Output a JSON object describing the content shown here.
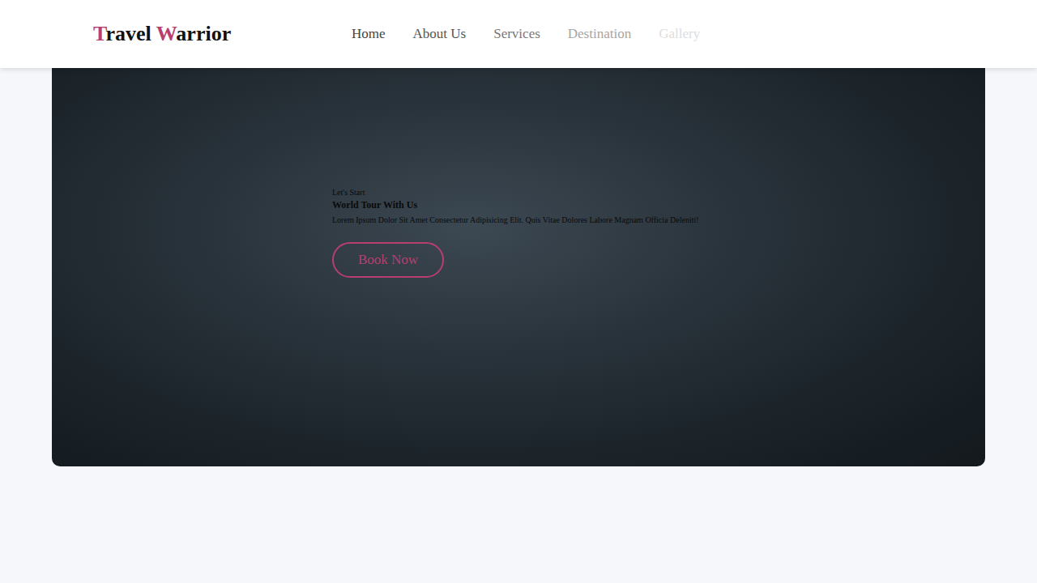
{
  "header": {
    "logo": [
      {
        "text": "T",
        "color": "#b83e6f"
      },
      {
        "text": "ravel ",
        "color": "#111111"
      },
      {
        "text": "W",
        "color": "#b83e6f"
      },
      {
        "text": "arrior",
        "color": "#111111"
      }
    ],
    "nav": [
      {
        "label": "Home",
        "color": "#444444"
      },
      {
        "label": "About Us",
        "color": "#555555"
      },
      {
        "label": "Services",
        "color": "#777777"
      },
      {
        "label": "Destination",
        "color": "#a5a5a5"
      },
      {
        "label": "Gallery",
        "color": "#dddddd"
      }
    ]
  },
  "hero": {
    "eyebrow": "Let's Start",
    "title": "World Tour With Us",
    "text": "Lorem Ipsum Dolor Sit Amet Consectetur Adipisicing Elit. Quis Vitae Dolores Labore Magnam Officia Deleniti!",
    "button": "Book Now"
  }
}
